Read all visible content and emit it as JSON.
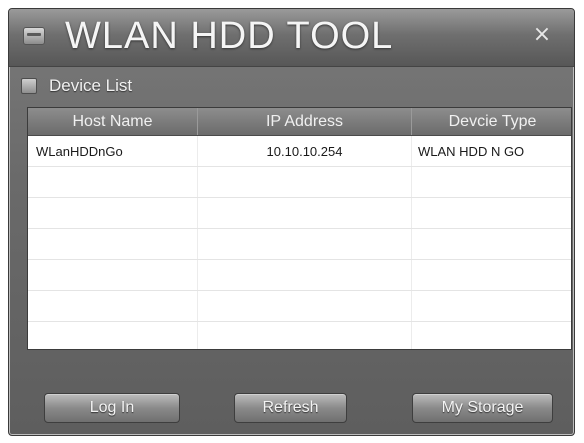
{
  "window": {
    "title": "WLAN HDD TOOL",
    "close_glyph": "×"
  },
  "device_list": {
    "label": "Device List",
    "columns": [
      "Host Name",
      "IP Address",
      "Devcie Type"
    ],
    "rows": [
      [
        "WLanHDDnGo",
        "10.10.10.254",
        "WLAN HDD N GO"
      ],
      [
        "",
        "",
        ""
      ],
      [
        "",
        "",
        ""
      ],
      [
        "",
        "",
        ""
      ],
      [
        "",
        "",
        ""
      ],
      [
        "",
        "",
        ""
      ],
      [
        "",
        "",
        ""
      ]
    ]
  },
  "buttons": {
    "login_label": "Log In",
    "refresh_label": "Refresh",
    "storage_label": "My Storage"
  },
  "icons": {
    "app": "hdd-icon",
    "list": "list-icon",
    "close": "close-icon"
  }
}
